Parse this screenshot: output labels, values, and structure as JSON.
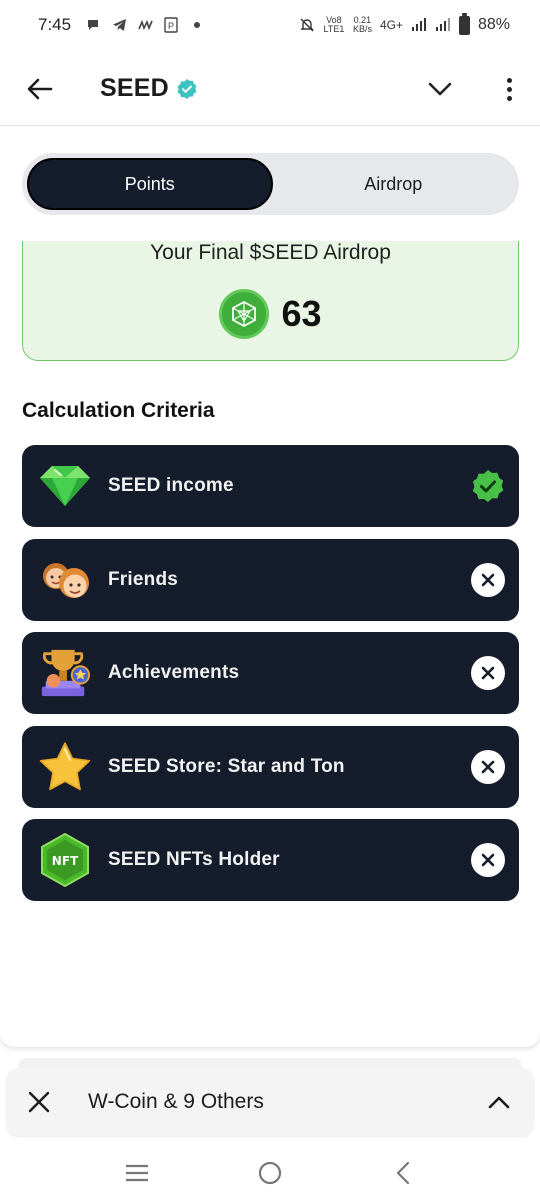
{
  "status_bar": {
    "time": "7:45",
    "network_volte": "Vo8 LTE1",
    "speed_value": "0.21",
    "speed_unit": "KB/s",
    "network_type": "4G+",
    "battery": "88%"
  },
  "header": {
    "title": "SEED",
    "icons": [
      "back-arrow-icon",
      "verified-badge-icon",
      "chevron-down-icon",
      "more-vertical-icon"
    ]
  },
  "tabs": [
    {
      "label": "Points",
      "active": true
    },
    {
      "label": "Airdrop",
      "active": false
    }
  ],
  "airdrop": {
    "title": "Your Final $SEED Airdrop",
    "value": "63"
  },
  "criteria": {
    "heading": "Calculation Criteria",
    "items": [
      {
        "label": "SEED income",
        "icon": "green-gem-icon",
        "status": "met"
      },
      {
        "label": "Friends",
        "icon": "friends-icon",
        "status": "not-met"
      },
      {
        "label": "Achievements",
        "icon": "trophy-icon",
        "status": "not-met"
      },
      {
        "label": "SEED Store: Star and Ton",
        "icon": "star-icon",
        "status": "not-met"
      },
      {
        "label": "SEED NFTs Holder",
        "icon": "nft-badge-icon",
        "status": "not-met"
      }
    ]
  },
  "notification": {
    "text": "W-Coin & 9 Others"
  },
  "colors": {
    "dark_card": "#151c2b",
    "accent_green": "#3fae3a",
    "airdrop_bg": "#e9f6e6",
    "verified_teal": "#3cc3c0"
  }
}
